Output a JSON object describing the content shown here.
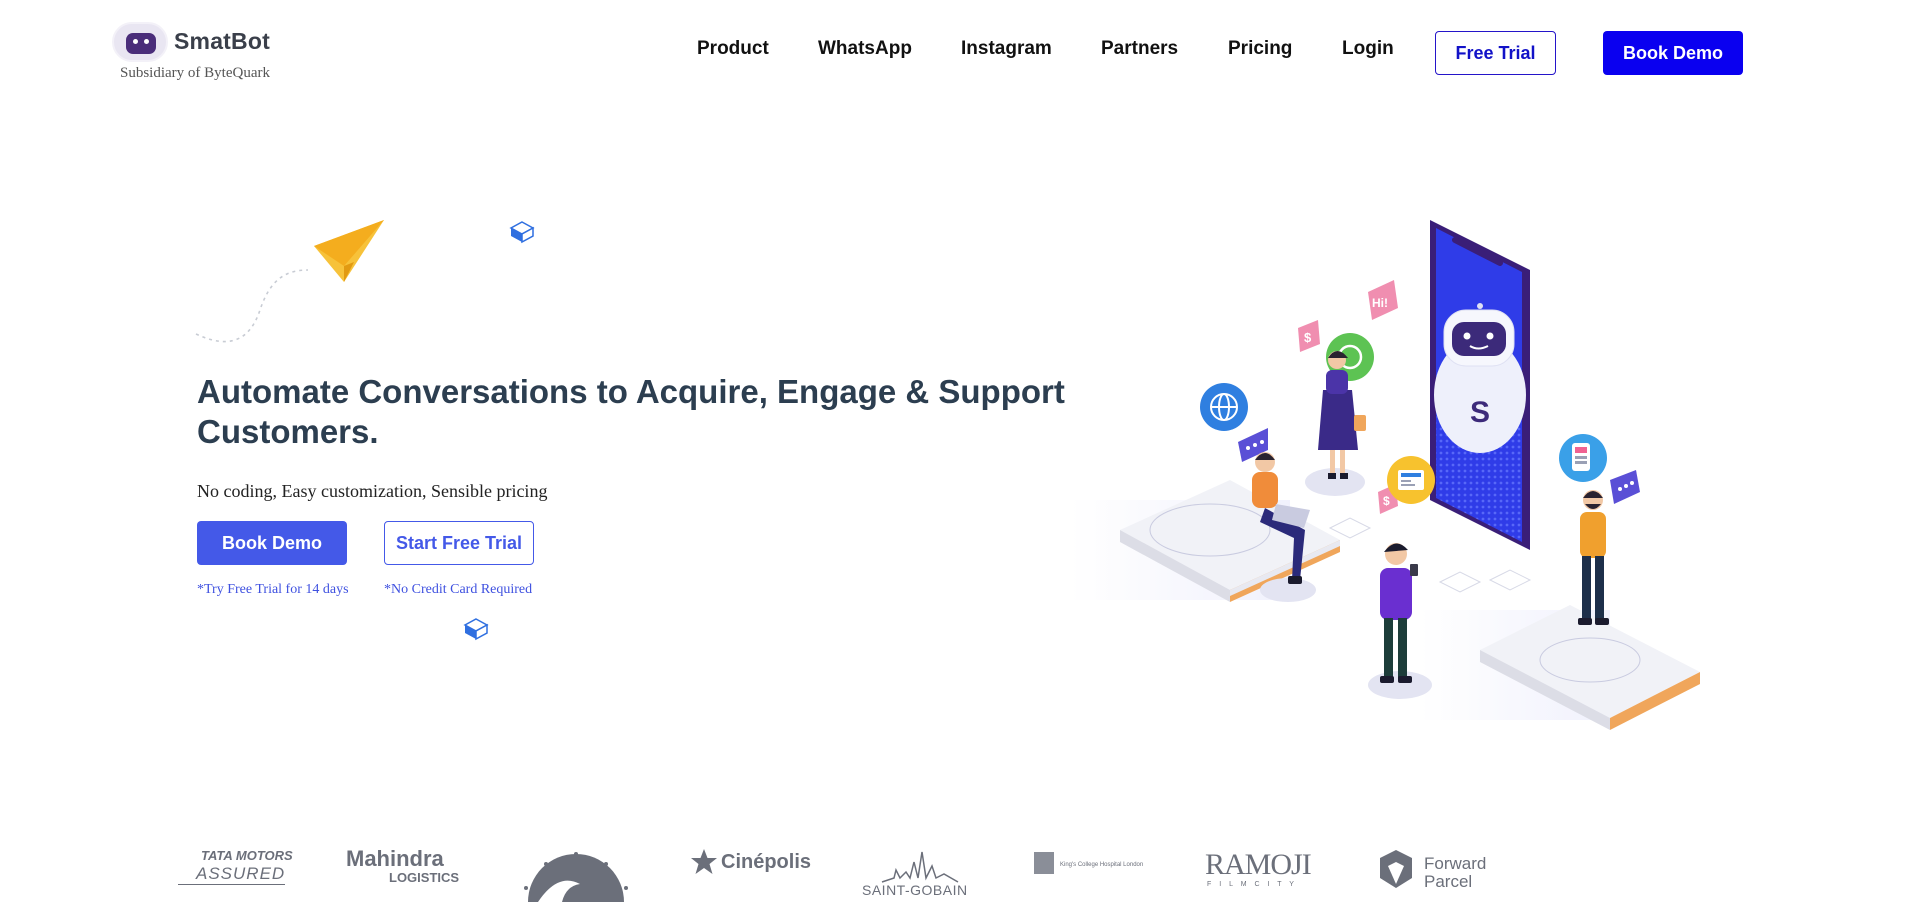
{
  "header": {
    "brand_name": "SmatBot",
    "brand_tagline": "Subsidiary of ByteQuark",
    "nav_items": [
      "Product",
      "WhatsApp",
      "Instagram",
      "Partners",
      "Pricing",
      "Login"
    ],
    "free_trial_label": "Free Trial",
    "book_demo_label": "Book Demo",
    "accent_color": "#0a00f0"
  },
  "hero": {
    "title": "Automate Conversations to Acquire, Engage & Support Customers.",
    "subtitle": "No coding, Easy customization, Sensible pricing",
    "primary_cta": "Book Demo",
    "secondary_cta": "Start Free Trial",
    "note_trial": "*Try Free Trial for 14 days",
    "note_card": "*No Credit Card Required",
    "button_color": "#4459e8"
  },
  "illustration": {
    "speech_hi": "Hi!",
    "robot_letter": "S",
    "icons": [
      "globe-icon",
      "whatsapp-icon",
      "dollar-chat-icon",
      "news-icon",
      "phone-app-icon",
      "chat-bubble-icon"
    ]
  },
  "clients": {
    "tata_line1": "TATA MOTORS",
    "tata_line2": "ASSURED",
    "mahindra_line1": "Mahindra",
    "mahindra_line2": "LOGISTICS",
    "cinepolis": "Cinépolis",
    "saint_gobain": "SAINT-GOBAIN",
    "kings_college": "King's College Hospital London",
    "ramoji_line1": "RAMOJI",
    "ramoji_line2": "F I L M  C I T Y",
    "forward_line1": "Forward",
    "forward_line2": "Parcel"
  }
}
